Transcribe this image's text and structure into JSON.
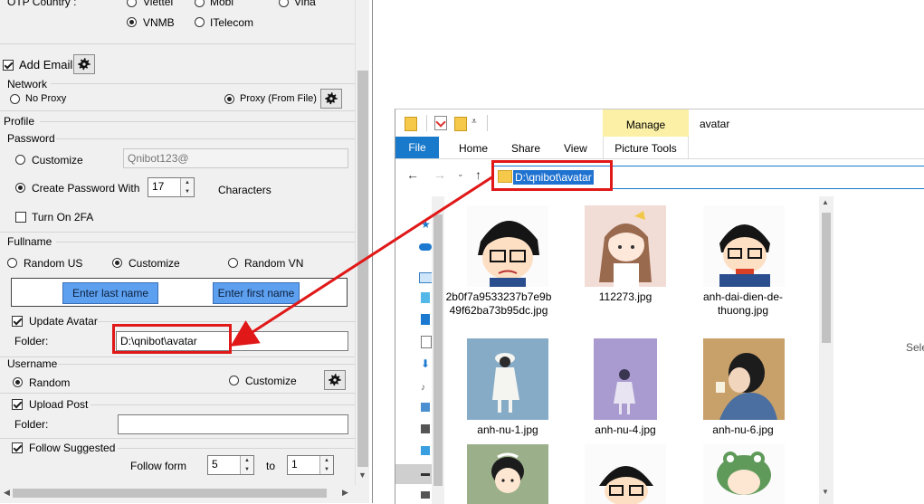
{
  "left_panel": {
    "otp": {
      "label": "OTP Country :",
      "options": [
        "Viettel",
        "Mobi",
        "Vina",
        "VNMB",
        "ITelecom"
      ],
      "selected": "VNMB"
    },
    "add_email": {
      "label": "Add Email",
      "checked": true
    },
    "network": {
      "title": "Network",
      "no_proxy": "No Proxy",
      "proxy_file": "Proxy (From File)",
      "selected": "Proxy (From File)"
    },
    "profile": {
      "title": "Profile",
      "password": {
        "title": "Password",
        "customize_label": "Customize",
        "customize_value": "Qnibot123@",
        "create_label": "Create Password With",
        "length_value": "17",
        "characters_label": "Characters",
        "twofa_label": "Turn On 2FA",
        "selected": "Create Password With"
      },
      "fullname": {
        "title": "Fullname",
        "random_us": "Random US",
        "customize": "Customize",
        "random_vn": "Random VN",
        "selected": "Customize",
        "last_name_btn": "Enter last name",
        "first_name_btn": "Enter first name"
      },
      "avatar": {
        "label": "Update Avatar",
        "checked": true,
        "folder_label": "Folder:",
        "folder_value": "D:\\qnibot\\avatar"
      },
      "username": {
        "title": "Username",
        "random": "Random",
        "customize": "Customize",
        "selected": "Random"
      },
      "upload_post": {
        "label": "Upload Post",
        "checked": true,
        "folder_label": "Folder:",
        "folder_value": ""
      },
      "follow": {
        "label": "Follow Suggested",
        "checked": true,
        "from_label": "Follow form",
        "from_value": "5",
        "to_label": "to",
        "to_value": "1"
      }
    }
  },
  "explorer": {
    "manage_tab": "Manage",
    "title": "avatar",
    "ribbon_tabs": [
      "File",
      "Home",
      "Share",
      "View"
    ],
    "picture_tools": "Picture Tools",
    "address": "D:\\qnibot\\avatar",
    "select_hint": "Sele",
    "files": [
      {
        "name": "2b0f7a9533237b7e9b49f62ba73b95dc.jpg"
      },
      {
        "name": "112273.jpg"
      },
      {
        "name": "anh-dai-dien-de-thuong.jpg"
      },
      {
        "name": "anh-nu-1.jpg"
      },
      {
        "name": "anh-nu-4.jpg"
      },
      {
        "name": "anh-nu-6.jpg"
      },
      {
        "name": ""
      },
      {
        "name": ""
      },
      {
        "name": ""
      }
    ]
  },
  "colors": {
    "accent_red": "#e01818",
    "ribbon_blue": "#1979ca",
    "manage_yellow": "#fbf0a6",
    "button_blue": "#5ea0f0"
  }
}
